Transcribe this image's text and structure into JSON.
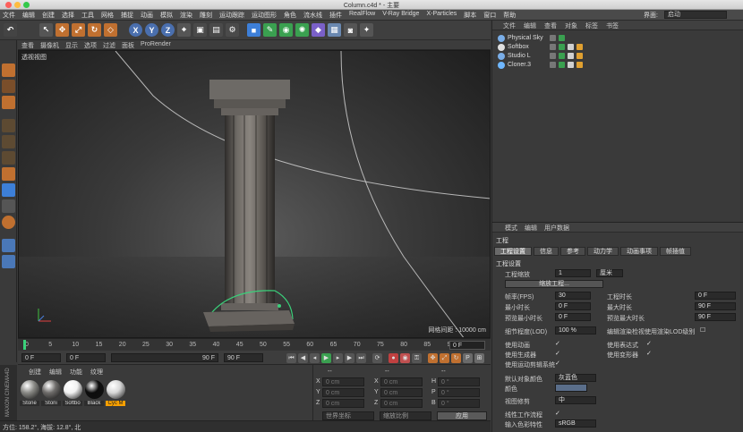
{
  "window": {
    "title": "Column.c4d * - 主要"
  },
  "menubar": {
    "items": [
      "文件",
      "编辑",
      "创建",
      "选择",
      "工具",
      "网格",
      "捕捉",
      "动画",
      "模拟",
      "渲染",
      "雕刻",
      "运动跟踪",
      "运动图形",
      "角色",
      "流水线",
      "插件",
      "RealFlow",
      "V-Ray Bridge",
      "X-Particles",
      "脚本",
      "窗口",
      "帮助"
    ],
    "layout_label": "界面:",
    "layout_value": "启动"
  },
  "viewport": {
    "menu": [
      "查看",
      "摄像机",
      "显示",
      "选项",
      "过滤",
      "面板",
      "ProRender"
    ],
    "label": "透视视图",
    "grid_spacing": "网格间距 : 10000 cm"
  },
  "timeline": {
    "ticks": [
      "0",
      "5",
      "10",
      "15",
      "20",
      "25",
      "30",
      "35",
      "40",
      "45",
      "50",
      "55",
      "60",
      "65",
      "70",
      "75",
      "80",
      "85",
      "90"
    ],
    "current_frame": "0 F"
  },
  "playbar": {
    "start": "0 F",
    "preview_start": "0 F",
    "preview_end": "90 F",
    "end": "90 F"
  },
  "materials": {
    "menu": [
      "创建",
      "编辑",
      "功能",
      "纹理"
    ],
    "items": [
      {
        "name": "Stone",
        "color": "#8a8a86"
      },
      {
        "name": "Stoni",
        "color": "#6e6c6a"
      },
      {
        "name": "Softbo",
        "color": "#f2f2f2"
      },
      {
        "name": "Black",
        "color": "#0d0d0d"
      },
      {
        "name": "Cyc M",
        "color": "#d8d8d8"
      }
    ]
  },
  "coordinates": {
    "headers": [
      "--",
      "--",
      "--"
    ],
    "rows": [
      {
        "a": "X",
        "av": "0 cm",
        "b": "X",
        "bv": "0 cm",
        "c": "H",
        "cv": "0 °"
      },
      {
        "a": "Y",
        "av": "0 cm",
        "b": "Y",
        "bv": "0 cm",
        "c": "P",
        "cv": "0 °"
      },
      {
        "a": "Z",
        "av": "0 cm",
        "b": "Z",
        "bv": "0 cm",
        "c": "B",
        "cv": "0 °"
      }
    ],
    "space": "世界坐标",
    "scale": "缩放比例",
    "apply": "应用"
  },
  "status": {
    "text": "方位: 158.2°, 海拔: 12.8°, 北"
  },
  "object_manager": {
    "menu": [
      "文件",
      "编辑",
      "查看",
      "对象",
      "标签",
      "书签"
    ],
    "objects": [
      {
        "name": "Physical Sky",
        "color": "#7aaee8"
      },
      {
        "name": "Softbox",
        "color": "#e0e0e0"
      },
      {
        "name": "Studio L",
        "color": "#7aaee8"
      },
      {
        "name": "Cloner.3",
        "color": "#6fb7ff"
      }
    ]
  },
  "attributes": {
    "menu": [
      "模式",
      "编辑",
      "用户数据"
    ],
    "header": "工程",
    "tabs": [
      "工程设置",
      "信息",
      "参考",
      "动力学",
      "动画事项",
      "帧插值"
    ],
    "section": "工程设置",
    "project_scale_label": "工程缩放",
    "project_scale_value": "1",
    "project_scale_unit": "厘米",
    "scale_project_button": "缩放工程...",
    "fps_label": "帧率(FPS)",
    "fps_value": "30",
    "min_time_label": "最小时长",
    "min_time_value": "0 F",
    "preview_min_label": "预览最小时长",
    "preview_min_value": "0 F",
    "project_time_label": "工程时长",
    "project_time_value": "0 F",
    "max_time_label": "最大时长",
    "max_time_value": "90 F",
    "preview_max_label": "预览最大时长",
    "preview_max_value": "90 F",
    "lod_label": "细节程度(LOD)",
    "lod_value": "100 %",
    "lod_editor_label": "编辑渲染检视使用渲染LOD级别",
    "use_animation_label": "使用动画",
    "use_expressions_label": "使用表达式",
    "use_generators_label": "使用生成器",
    "use_deformers_label": "使用变形器",
    "use_motion_label": "使用运动剪辑系统",
    "default_color_label": "默认对象颜色",
    "default_color_value": "灰蓝色",
    "color_label": "颜色",
    "view_clip_label": "视图修剪",
    "view_clip_value": "中",
    "linear_workflow_label": "线性工作流程",
    "input_color_label": "输入色彩特性",
    "input_color_value": "sRGB"
  }
}
